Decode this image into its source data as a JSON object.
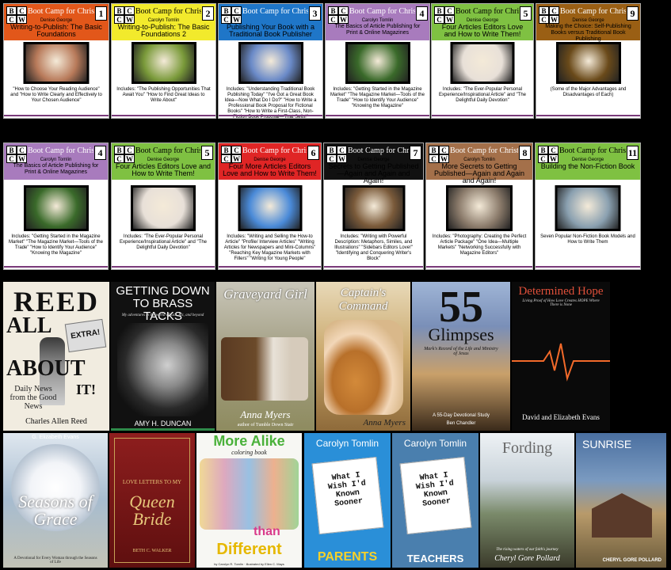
{
  "bccw_series": "Boot Camp for Christian Writers",
  "logo_letters": [
    "B",
    "C",
    "C",
    "W"
  ],
  "row1": [
    {
      "num": "1",
      "author": "Denise George",
      "title": "Writing-to-Publish: The Basic Foundations",
      "bullets": "\"How to Choose Your Reading Audience\" and \"How to Write Clearly and Effectively to Your Chosen Audience\"",
      "bg": "#e2571a"
    },
    {
      "num": "2",
      "author": "Carolyn Tomlin",
      "title": "Writing-to-Publish: The Basic Foundations 2",
      "bullets": "Includes: \"The Publishing Opportunities That Await You\" \"How to Find Great Ideas to Write About\"",
      "bg": "#f2ea2c"
    },
    {
      "num": "3",
      "author": "",
      "title": "Publishing Your Book with a Traditional Book Publisher",
      "bullets": "Includes: \"Understanding Traditional Book Publishing Today\" \"I've Got a Great Book Idea—Now What Do I Do?\" \"How to Write a Professional Book Proposal for Fictional Books\" \"How to Write a First-Class, Non-Fiction Book Proposal—That Sells!\"",
      "bg": "#1f76c8"
    },
    {
      "num": "4",
      "author": "Carolyn Tomlin",
      "title": "The Basics of Article Publishing for Print & Online Magazines",
      "bullets": "Includes: \"Getting Started in the Magazine Market\" \"The Magazine Market—Tools of the Trade\" \"How to Identify Your Audience\" \"Knowing the Magazine\"",
      "bg": "#a87bbd"
    },
    {
      "num": "5",
      "author": "Denise George",
      "title": "Four Articles Editors Love and How to Write Them!",
      "bullets": "Includes: \"The Ever-Popular Personal Experience/Inspirational Article\" and \"The Delightful Daily Devotion\"",
      "bg": "#7fc142"
    },
    {
      "num": "9",
      "author": "Denise George",
      "title": "Making the Choice: Self-Publishing Books versus Traditional Book Publishing",
      "bullets": "(Some of the Major Advantages and Disadvantages of Each)",
      "bg": "#9a5f14"
    }
  ],
  "row2": [
    {
      "num": "4",
      "author": "Carolyn Tomlin",
      "title": "The Basics of Article Publishing for Print & Online Magazines",
      "bullets": "Includes: \"Getting Started in the Magazine Market\" \"The Magazine Market—Tools of the Trade\" \"How to Identify Your Audience\" \"Knowing the Magazine\"",
      "bg": "#a87bbd"
    },
    {
      "num": "5",
      "author": "Denise George",
      "title": "Four Articles Editors Love and How to Write Them!",
      "bullets": "Includes: \"The Ever-Popular Personal Experience/Inspirational Article\" and \"The Delightful Daily Devotion\"",
      "bg": "#7fc142"
    },
    {
      "num": "6",
      "author": "Denise George",
      "title": "Four More Articles Editors Love and How to Write Them!",
      "bullets": "Includes: \"Writing and Selling the How-to Article\" \"Profile/ Interview Articles\" \"Writing Articles for Newspapers and Mini-Columns\" \"Reaching Key Magazine Markets with Fillers\" \"Writing for Young People\"",
      "bg": "#e02525"
    },
    {
      "num": "7",
      "author": "Denise George",
      "title": "Secrets to Getting Published—Again and Again and Again!",
      "bullets": "Includes: \"Writing with Powerful Description: Metaphors, Similes, and Illustrations\" \"Sidebars Editors Love!\" \"Identifying and Conquering Writer's Block\"",
      "bg": "#111111"
    },
    {
      "num": "8",
      "author": "Carolyn Tomlin",
      "title": "More Secrets to Getting Published—Again and Again and Again!",
      "bullets": "Includes: \"Photography: Creating the Perfect Article Package\" \"One Idea—Multiple Markets\" \"Networking Successfully with Magazine Editors\"",
      "bg": "#a4704a"
    },
    {
      "num": "11",
      "author": "Denise George",
      "title": "Building the Non-Fiction Book",
      "bullets": "Seven Popular Non-Fiction Book Models and How to Write Them",
      "bg": "#7fc142"
    }
  ],
  "row3": [
    {
      "title": "REED",
      "title2": "ALL",
      "title3": "ABOUT",
      "title4": "IT!",
      "sub": "Daily News from the Good News",
      "author": "Charles Allen Reed",
      "paper": "EXTRA!"
    },
    {
      "title": "GETTING DOWN TO BRASS TACKS",
      "sub": "My adventures in the world of jazz, Riz, and beyond",
      "author": "AMY H. DUNCAN"
    },
    {
      "title": "Graveyard Girl",
      "author": "Anna Myers",
      "small": "author of Tumble Down Stair"
    },
    {
      "title": "Captain's Command",
      "author": "Anna Myers"
    },
    {
      "title": "55",
      "title2": "Glimpses",
      "sub": "Mark's Record of the Life and Ministry of Jesus",
      "sub2": "A 55-Day Devotional Study",
      "author": "Ben Chandler"
    },
    {
      "title": "Determined Hope",
      "sub": "Living Proof of How Love Creates HOPE Where There is None",
      "author": "David and Elizabeth Evans"
    }
  ],
  "row4": [
    {
      "author": "G. Elizabeth Evans",
      "title": "Seasons of Grace",
      "sub": "A Devotional for Every Woman through the Seasons of Life"
    },
    {
      "title": "LOVE LETTERS TO MY",
      "title2": "Queen Bride",
      "author": "BETH C. WALKER"
    },
    {
      "title": "More Alike",
      "sub": "coloring book",
      "title2": "than",
      "title3": "Different",
      "author": "by Carolyn R. Tomlin · illustrated by Ellen C. Mays"
    },
    {
      "author": "Carolyn Tomlin",
      "title": "What I Wish I'd Known Sooner",
      "title2": "PARENTS"
    },
    {
      "author": "Carolyn Tomlin",
      "title": "What I Wish I'd Known Sooner",
      "title2": "TEACHERS"
    },
    {
      "title": "Fording",
      "sub": "The rising waters of our faith's journey",
      "author": "Cheryl Gore Pollard"
    },
    {
      "title": "SUNRISE",
      "author": "CHERYL GORE POLLARD"
    }
  ]
}
